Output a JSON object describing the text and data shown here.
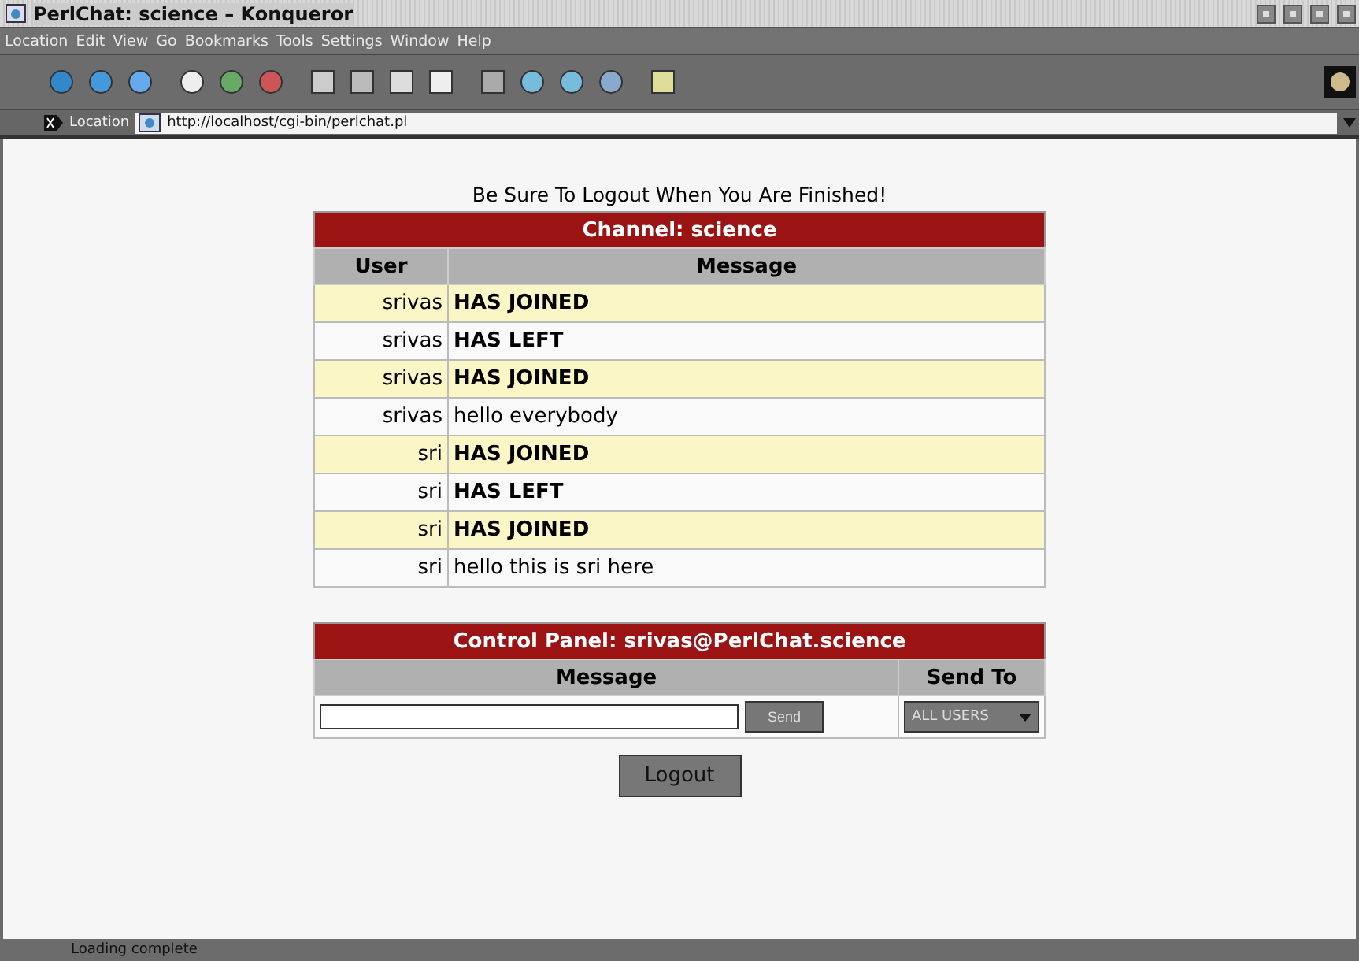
{
  "window": {
    "title": "PerlChat: science – Konqueror"
  },
  "menu": [
    "Location",
    "Edit",
    "View",
    "Go",
    "Bookmarks",
    "Tools",
    "Settings",
    "Window",
    "Help"
  ],
  "location": {
    "label": "Location",
    "url": "http://localhost/cgi-bin/perlchat.pl"
  },
  "page": {
    "notice": "Be Sure To Logout When You Are Finished!",
    "channel": {
      "title": "Channel: science",
      "columns": [
        "User",
        "Message"
      ],
      "rows": [
        {
          "user": "srivas",
          "message": "HAS JOINED",
          "kind": "event"
        },
        {
          "user": "srivas",
          "message": "HAS LEFT",
          "kind": "event"
        },
        {
          "user": "srivas",
          "message": "HAS JOINED",
          "kind": "event"
        },
        {
          "user": "srivas",
          "message": "hello everybody",
          "kind": "message"
        },
        {
          "user": "sri",
          "message": "HAS JOINED",
          "kind": "event"
        },
        {
          "user": "sri",
          "message": "HAS LEFT",
          "kind": "event"
        },
        {
          "user": "sri",
          "message": "HAS JOINED",
          "kind": "event"
        },
        {
          "user": "sri",
          "message": "hello this is sri here",
          "kind": "message"
        }
      ]
    },
    "control": {
      "title": "Control Panel: srivas@PerlChat.science",
      "columns": [
        "Message",
        "Send To"
      ],
      "send_button": "Send",
      "send_to": "ALL USERS"
    },
    "logout_button": "Logout"
  },
  "status_bar": "Loading complete"
}
